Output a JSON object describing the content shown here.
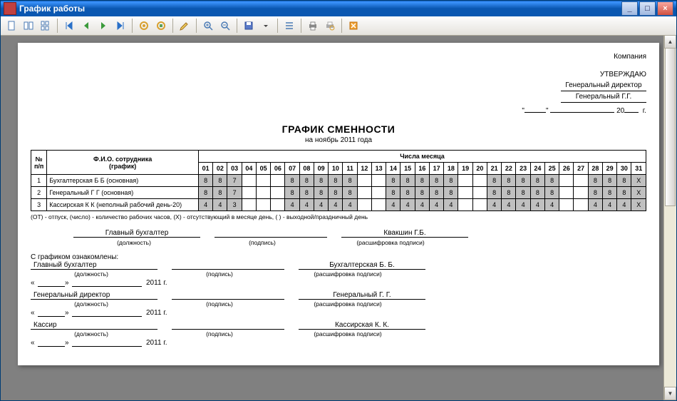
{
  "window_title": "График работы",
  "header": {
    "company": "Компания",
    "approve": "УТВЕРЖДАЮ",
    "position": "Генеральный директор",
    "name": "Генеральный Г.Г.",
    "year_prefix": "20",
    "year_suffix": "г."
  },
  "title": "ГРАФИК СМЕННОСТИ",
  "subtitle": "на ноябрь 2011 года",
  "table": {
    "col_num": "№ п/п",
    "col_name": "Ф.И.О. сотрудника",
    "col_name_sub": "(график)",
    "col_days_title": "Числа месяца",
    "days": [
      "01",
      "02",
      "03",
      "04",
      "05",
      "06",
      "07",
      "08",
      "09",
      "10",
      "11",
      "12",
      "13",
      "14",
      "15",
      "16",
      "17",
      "18",
      "19",
      "20",
      "21",
      "22",
      "23",
      "24",
      "25",
      "26",
      "27",
      "28",
      "29",
      "30",
      "31"
    ],
    "rows": [
      {
        "n": "1",
        "name": "Бухгалтерская Б Б (основная)",
        "cells": [
          "8",
          "8",
          "7",
          "",
          "",
          "",
          "8",
          "8",
          "8",
          "8",
          "8",
          "",
          "",
          "8",
          "8",
          "8",
          "8",
          "8",
          "",
          "",
          "8",
          "8",
          "8",
          "8",
          "8",
          "",
          "",
          "8",
          "8",
          "8",
          "X"
        ]
      },
      {
        "n": "2",
        "name": "Генеральный Г Г (основная)",
        "cells": [
          "8",
          "8",
          "7",
          "",
          "",
          "",
          "8",
          "8",
          "8",
          "8",
          "8",
          "",
          "",
          "8",
          "8",
          "8",
          "8",
          "8",
          "",
          "",
          "8",
          "8",
          "8",
          "8",
          "8",
          "",
          "",
          "8",
          "8",
          "8",
          "X"
        ]
      },
      {
        "n": "3",
        "name": "Кассирская К К (неполный рабочий день-20)",
        "cells": [
          "4",
          "4",
          "3",
          "",
          "",
          "",
          "4",
          "4",
          "4",
          "4",
          "4",
          "",
          "",
          "4",
          "4",
          "4",
          "4",
          "4",
          "",
          "",
          "4",
          "4",
          "4",
          "4",
          "4",
          "",
          "",
          "4",
          "4",
          "4",
          "X"
        ]
      }
    ],
    "gray_days_idx": [
      3,
      4,
      5,
      11,
      12,
      18,
      19,
      25,
      26,
      30
    ],
    "gray_row_cells_idx": [
      0,
      1,
      2,
      6,
      7,
      8,
      9,
      10,
      13,
      14,
      15,
      16,
      17,
      20,
      21,
      22,
      23,
      24,
      27,
      28,
      29
    ]
  },
  "legend": "(ОТ) - отпуск, (число) - количество рабочих часов, (X) - отсутствующий в месяце день, ( ) - выходной/праздничный день",
  "sig1": {
    "pos_value": "Главный бухгалтер",
    "pos_label": "(должность)",
    "sign_label": "(подпись)",
    "name_value": "Квакшин Г.Б.",
    "name_label": "(расшифровка подписи)"
  },
  "ack_title": "С графиком ознакомлены:",
  "ack": [
    {
      "pos": "Главный бухгалтер",
      "name": "Бухгалтерская Б. Б."
    },
    {
      "pos": "Генеральный директор",
      "name": "Генеральный Г. Г."
    },
    {
      "pos": "Кассир",
      "name": "Кассирская К. К."
    }
  ],
  "ack_labels": {
    "pos": "(должность)",
    "sign": "(подпись)",
    "name": "(расшифровка подписи)",
    "year": "2011 г."
  },
  "quote": "\""
}
